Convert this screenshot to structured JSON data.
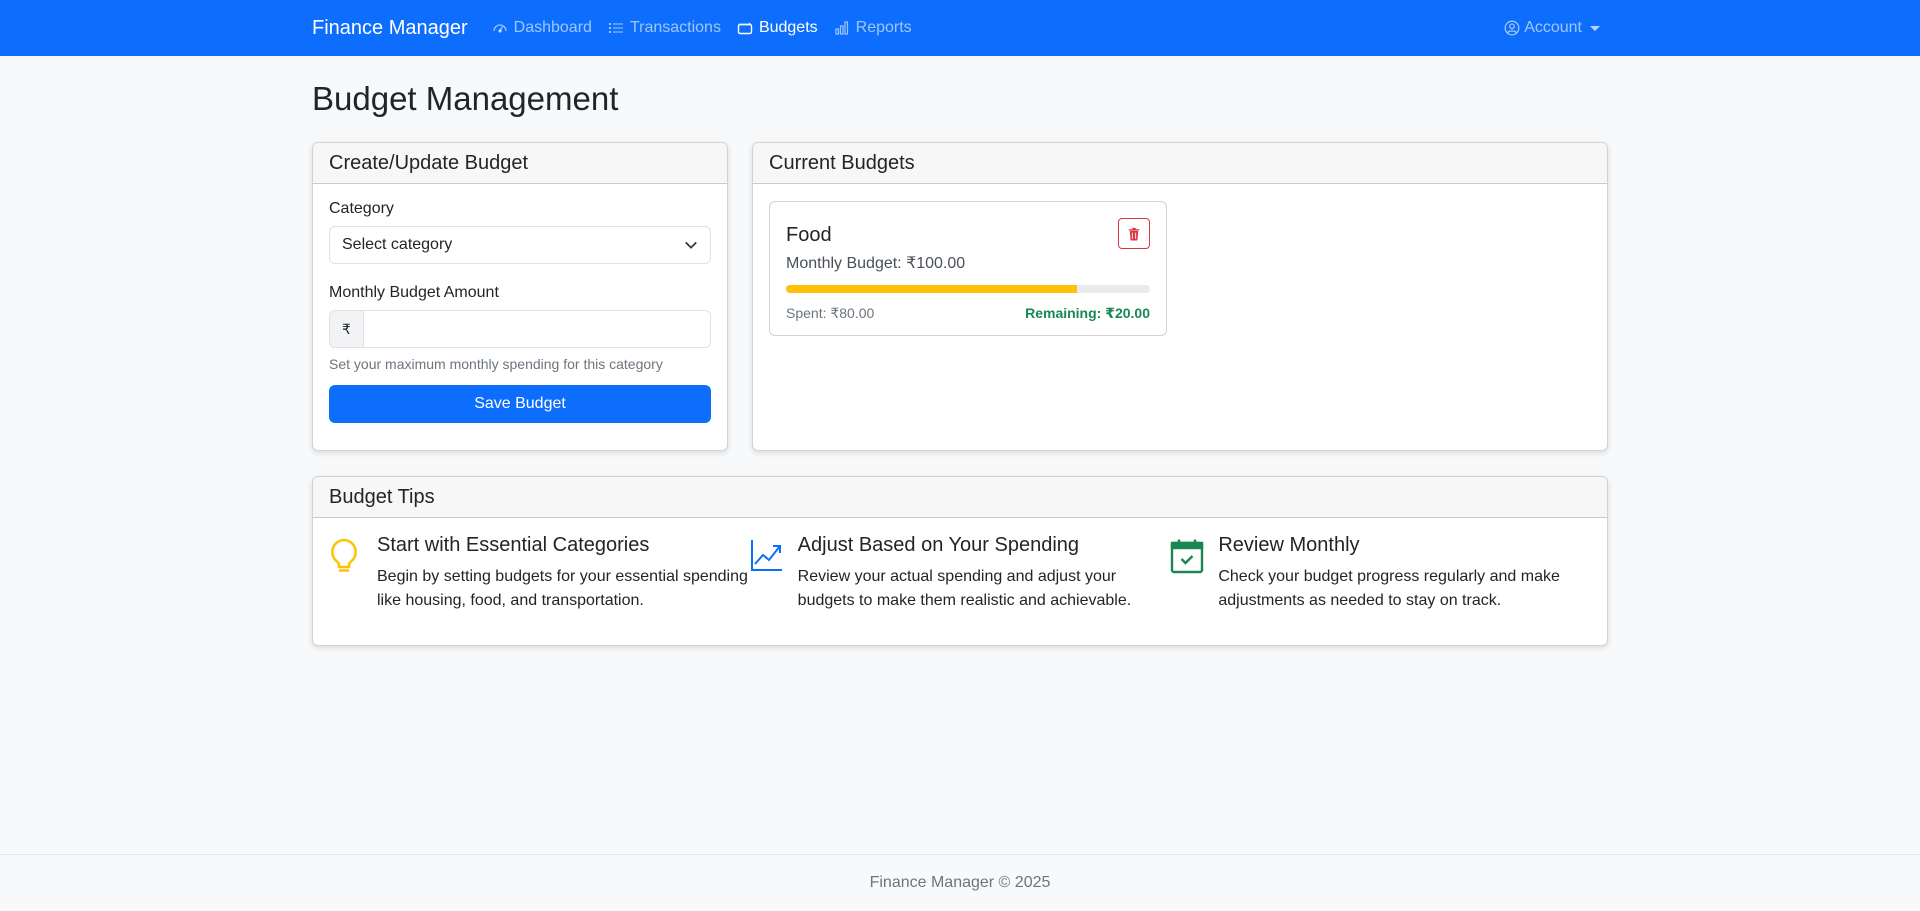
{
  "navbar": {
    "brand": "Finance Manager",
    "links": [
      {
        "label": "Dashboard",
        "icon": "speedometer-icon"
      },
      {
        "label": "Transactions",
        "icon": "list-icon"
      },
      {
        "label": "Budgets",
        "icon": "wallet-icon"
      },
      {
        "label": "Reports",
        "icon": "bar-chart-icon"
      }
    ],
    "active": "Budgets",
    "account_label": "Account"
  },
  "page": {
    "title": "Budget Management"
  },
  "create_form": {
    "header": "Create/Update Budget",
    "category_label": "Category",
    "category_selected": "Select category",
    "amount_label": "Monthly Budget Amount",
    "currency_symbol": "₹",
    "amount_value": "",
    "help_text": "Set your maximum monthly spending for this category",
    "save_label": "Save Budget"
  },
  "current_budgets": {
    "header": "Current Budgets",
    "items": [
      {
        "name": "Food",
        "monthly": "Monthly Budget: ₹100.00",
        "spent": "Spent: ₹80.00",
        "remaining": "Remaining: ₹20.00",
        "progress_percent": 80
      }
    ]
  },
  "tips": {
    "header": "Budget Tips",
    "items": [
      {
        "title": "Start with Essential Categories",
        "text": "Begin by setting budgets for your essential spending like housing, food, and transportation.",
        "icon": "lightbulb-icon"
      },
      {
        "title": "Adjust Based on Your Spending",
        "text": "Review your actual spending and adjust your budgets to make them realistic and achievable.",
        "icon": "graph-up-icon"
      },
      {
        "title": "Review Monthly",
        "text": "Check your budget progress regularly and make adjustments as needed to stay on track.",
        "icon": "calendar-check-icon"
      }
    ]
  },
  "colors": {
    "primary": "#0d6efd",
    "warning": "#ffc107",
    "success": "#198754",
    "danger": "#dc3545"
  },
  "footer": {
    "text": "Finance Manager © 2025"
  }
}
